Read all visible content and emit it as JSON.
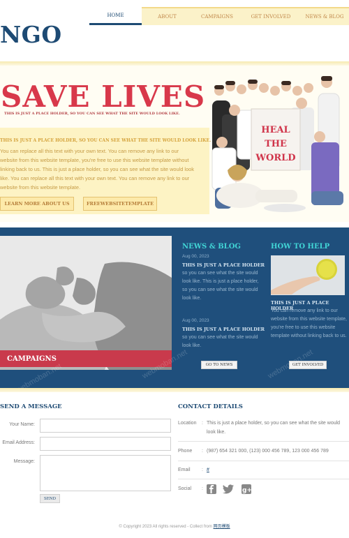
{
  "header": {
    "logo": "NGO",
    "nav": [
      {
        "label": "HOME",
        "active": true
      },
      {
        "label": "ABOUT",
        "active": false
      },
      {
        "label": "CAMPAIGNS",
        "active": false
      },
      {
        "label": "GET INVOLVED",
        "active": false
      },
      {
        "label": "NEWS & BLOG",
        "active": false
      }
    ]
  },
  "hero": {
    "title": "SAVE LIVES",
    "subtitle": "THIS IS JUST A PLACE HOLDER, SO YOU CAN SEE WHAT THE SITE WOULD LOOK LIKE.",
    "lead": "THIS IS JUST A PLACE HOLDER, SO YOU CAN SEE WHAT THE SITE WOULD LOOK LIKE.",
    "body": "You can replace all this text with your own text. You can remove any link to our website from this website template, you're free to use this website template without linking back to us. This is just a place holder, so you can see what the site would look like. You can replace all this text with your own text. You can remove any link to our website from this website template.",
    "learn_more": "LEARN MORE ABOUT US",
    "free_template": "FREEWEBSITETEMPLATE",
    "sign_lines": [
      "HEAL",
      "THE",
      "WORLD"
    ]
  },
  "campaigns": {
    "label": "CAMPAIGNS"
  },
  "news": {
    "heading": "NEWS & BLOG",
    "posts": [
      {
        "date": "Aug 00, 2023",
        "title": "THIS IS JUST A PLACE HOLDER",
        "text": "so you can see what the site would look like. This is just a place holder, so you can see what the site would look like."
      },
      {
        "date": "Aug 00, 2023",
        "title": "THIS IS JUST A PLACE HOLDER",
        "text": "so you can see what the site would look like."
      }
    ],
    "button": "GO TO NEWS"
  },
  "help": {
    "heading": "HOW TO HELP",
    "title": "THIS IS JUST A PLACE HOLDER",
    "text": "You can remove any link to our website from this website template, you're free to use this website template without linking back to us.",
    "button": "GET INVOLVED"
  },
  "message": {
    "heading": "SEND A MESSAGE",
    "name_label": "Your Name:",
    "email_label": "Email Address:",
    "message_label": "Message:",
    "send": "SEND"
  },
  "contact": {
    "heading": "CONTACT DETAILS",
    "location_label": "Location",
    "location_value": "This is just a place holder, so you can see what the site would look like.",
    "phone_label": "Phone",
    "phone_value": "(987) 654 321 000, (123) 000 456 789, 123 000 456 789",
    "email_label": "Email",
    "email_value": "#",
    "social_label": "Social",
    "social_icons": [
      "facebook-icon",
      "twitter-icon",
      "googleplus-icon"
    ]
  },
  "footer": {
    "text": "© Copyright 2023 All rights reserved - Collect from ",
    "link": "网页模板"
  },
  "colors": {
    "brand_blue": "#1d4a73",
    "accent_red": "#d8384a",
    "accent_cyan": "#41d5d6",
    "cream": "#fdf3c4"
  }
}
